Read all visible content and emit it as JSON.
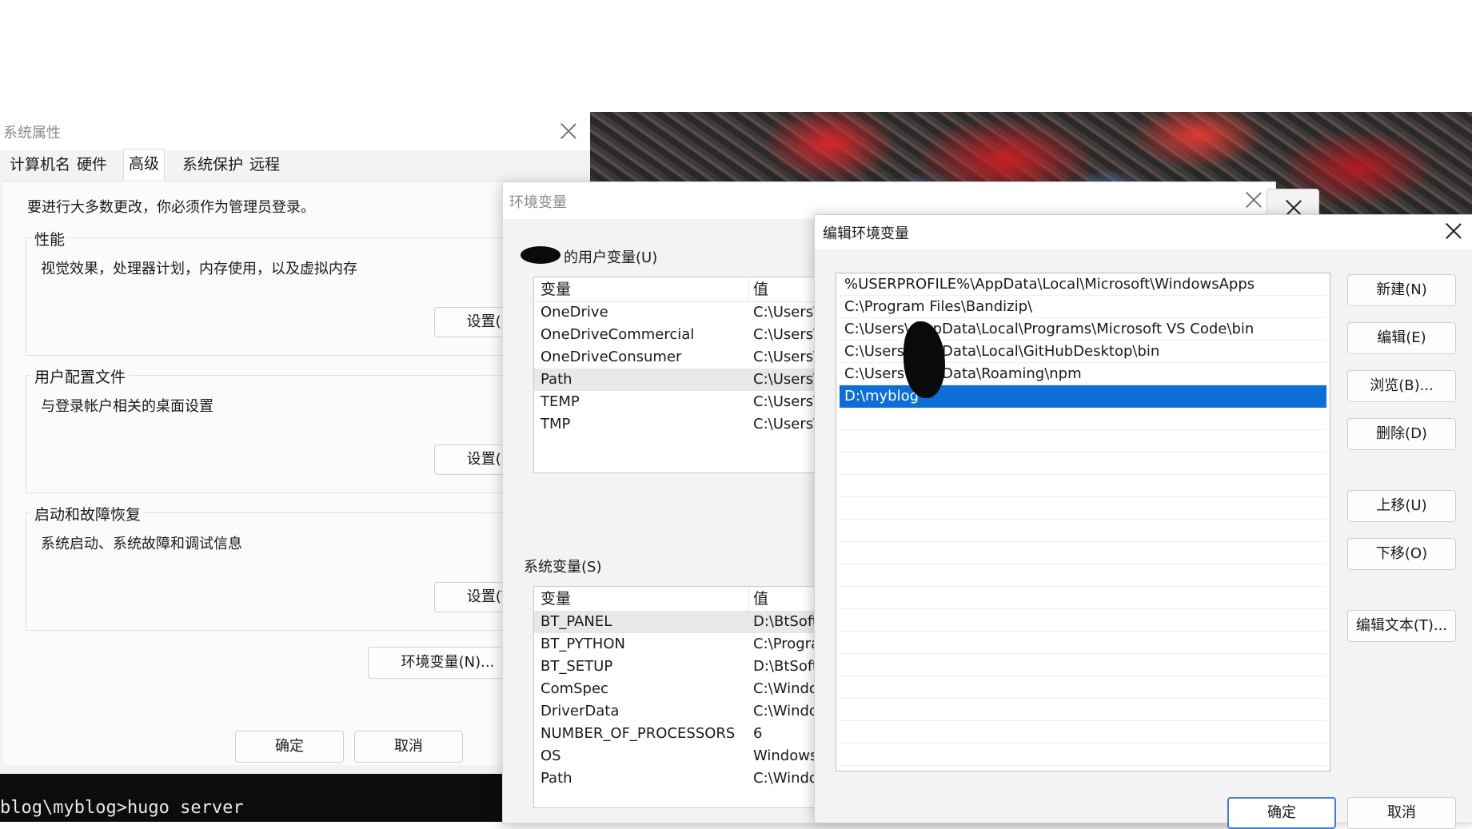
{
  "terminal": {
    "prompt_text": "blog\\myblog>hugo server"
  },
  "system_properties": {
    "title": "系统属性",
    "tabs": [
      {
        "label": "计算机名"
      },
      {
        "label": "硬件"
      },
      {
        "label": "高级"
      },
      {
        "label": "系统保护"
      },
      {
        "label": "远程"
      }
    ],
    "admin_note": "要进行大多数更改，你必须作为管理员登录。",
    "performance": {
      "label": "性能",
      "desc": "视觉效果，处理器计划，内存使用，以及虚拟内存",
      "button": "设置(S)..."
    },
    "user_profiles": {
      "label": "用户配置文件",
      "desc": "与登录帐户相关的桌面设置",
      "button": "设置(E)..."
    },
    "startup_recovery": {
      "label": "启动和故障恢复",
      "desc": "系统启动、系统故障和调试信息",
      "button": "设置(T)..."
    },
    "env_button": "环境变量(N)...",
    "ok": "确定",
    "cancel": "取消"
  },
  "env_vars": {
    "title": "环境变量",
    "user_section_label": "的用户变量(U)",
    "col_var": "变量",
    "col_val": "值",
    "user_vars": [
      {
        "name": "OneDrive",
        "value": "C:\\Users\\"
      },
      {
        "name": "OneDriveCommercial",
        "value": "C:\\Users\\"
      },
      {
        "name": "OneDriveConsumer",
        "value": "C:\\Users\\"
      },
      {
        "name": "Path",
        "value": "C:\\Users\\"
      },
      {
        "name": "TEMP",
        "value": "C:\\Users\\"
      },
      {
        "name": "TMP",
        "value": "C:\\Users\\"
      }
    ],
    "system_section_label": "系统变量(S)",
    "system_vars": [
      {
        "name": "BT_PANEL",
        "value": "D:\\BtSoft"
      },
      {
        "name": "BT_PYTHON",
        "value": "C:\\Progra"
      },
      {
        "name": "BT_SETUP",
        "value": "D:\\BtSoft"
      },
      {
        "name": "ComSpec",
        "value": "C:\\Windo"
      },
      {
        "name": "DriverData",
        "value": "C:\\Windo"
      },
      {
        "name": "NUMBER_OF_PROCESSORS",
        "value": "6"
      },
      {
        "name": "OS",
        "value": "Windows"
      },
      {
        "name": "Path",
        "value": "C:\\Windo"
      }
    ]
  },
  "edit_env": {
    "title": "编辑环境变量",
    "entries": [
      "%USERPROFILE%\\AppData\\Local\\Microsoft\\WindowsApps",
      "C:\\Program Files\\Bandizip\\",
      "C:\\Users\\         AppData\\Local\\Programs\\Microsoft VS Code\\bin",
      "C:\\Users\\         AppData\\Local\\GitHubDesktop\\bin",
      "C:\\Users\\         AppData\\Roaming\\npm",
      "D:\\myblog"
    ],
    "selected_index": 5,
    "buttons": {
      "new": "新建(N)",
      "edit": "编辑(E)",
      "browse": "浏览(B)...",
      "delete": "删除(D)",
      "move_up": "上移(U)",
      "move_down": "下移(O)",
      "edit_text": "编辑文本(T)..."
    },
    "ok": "确定",
    "cancel": "取消"
  }
}
